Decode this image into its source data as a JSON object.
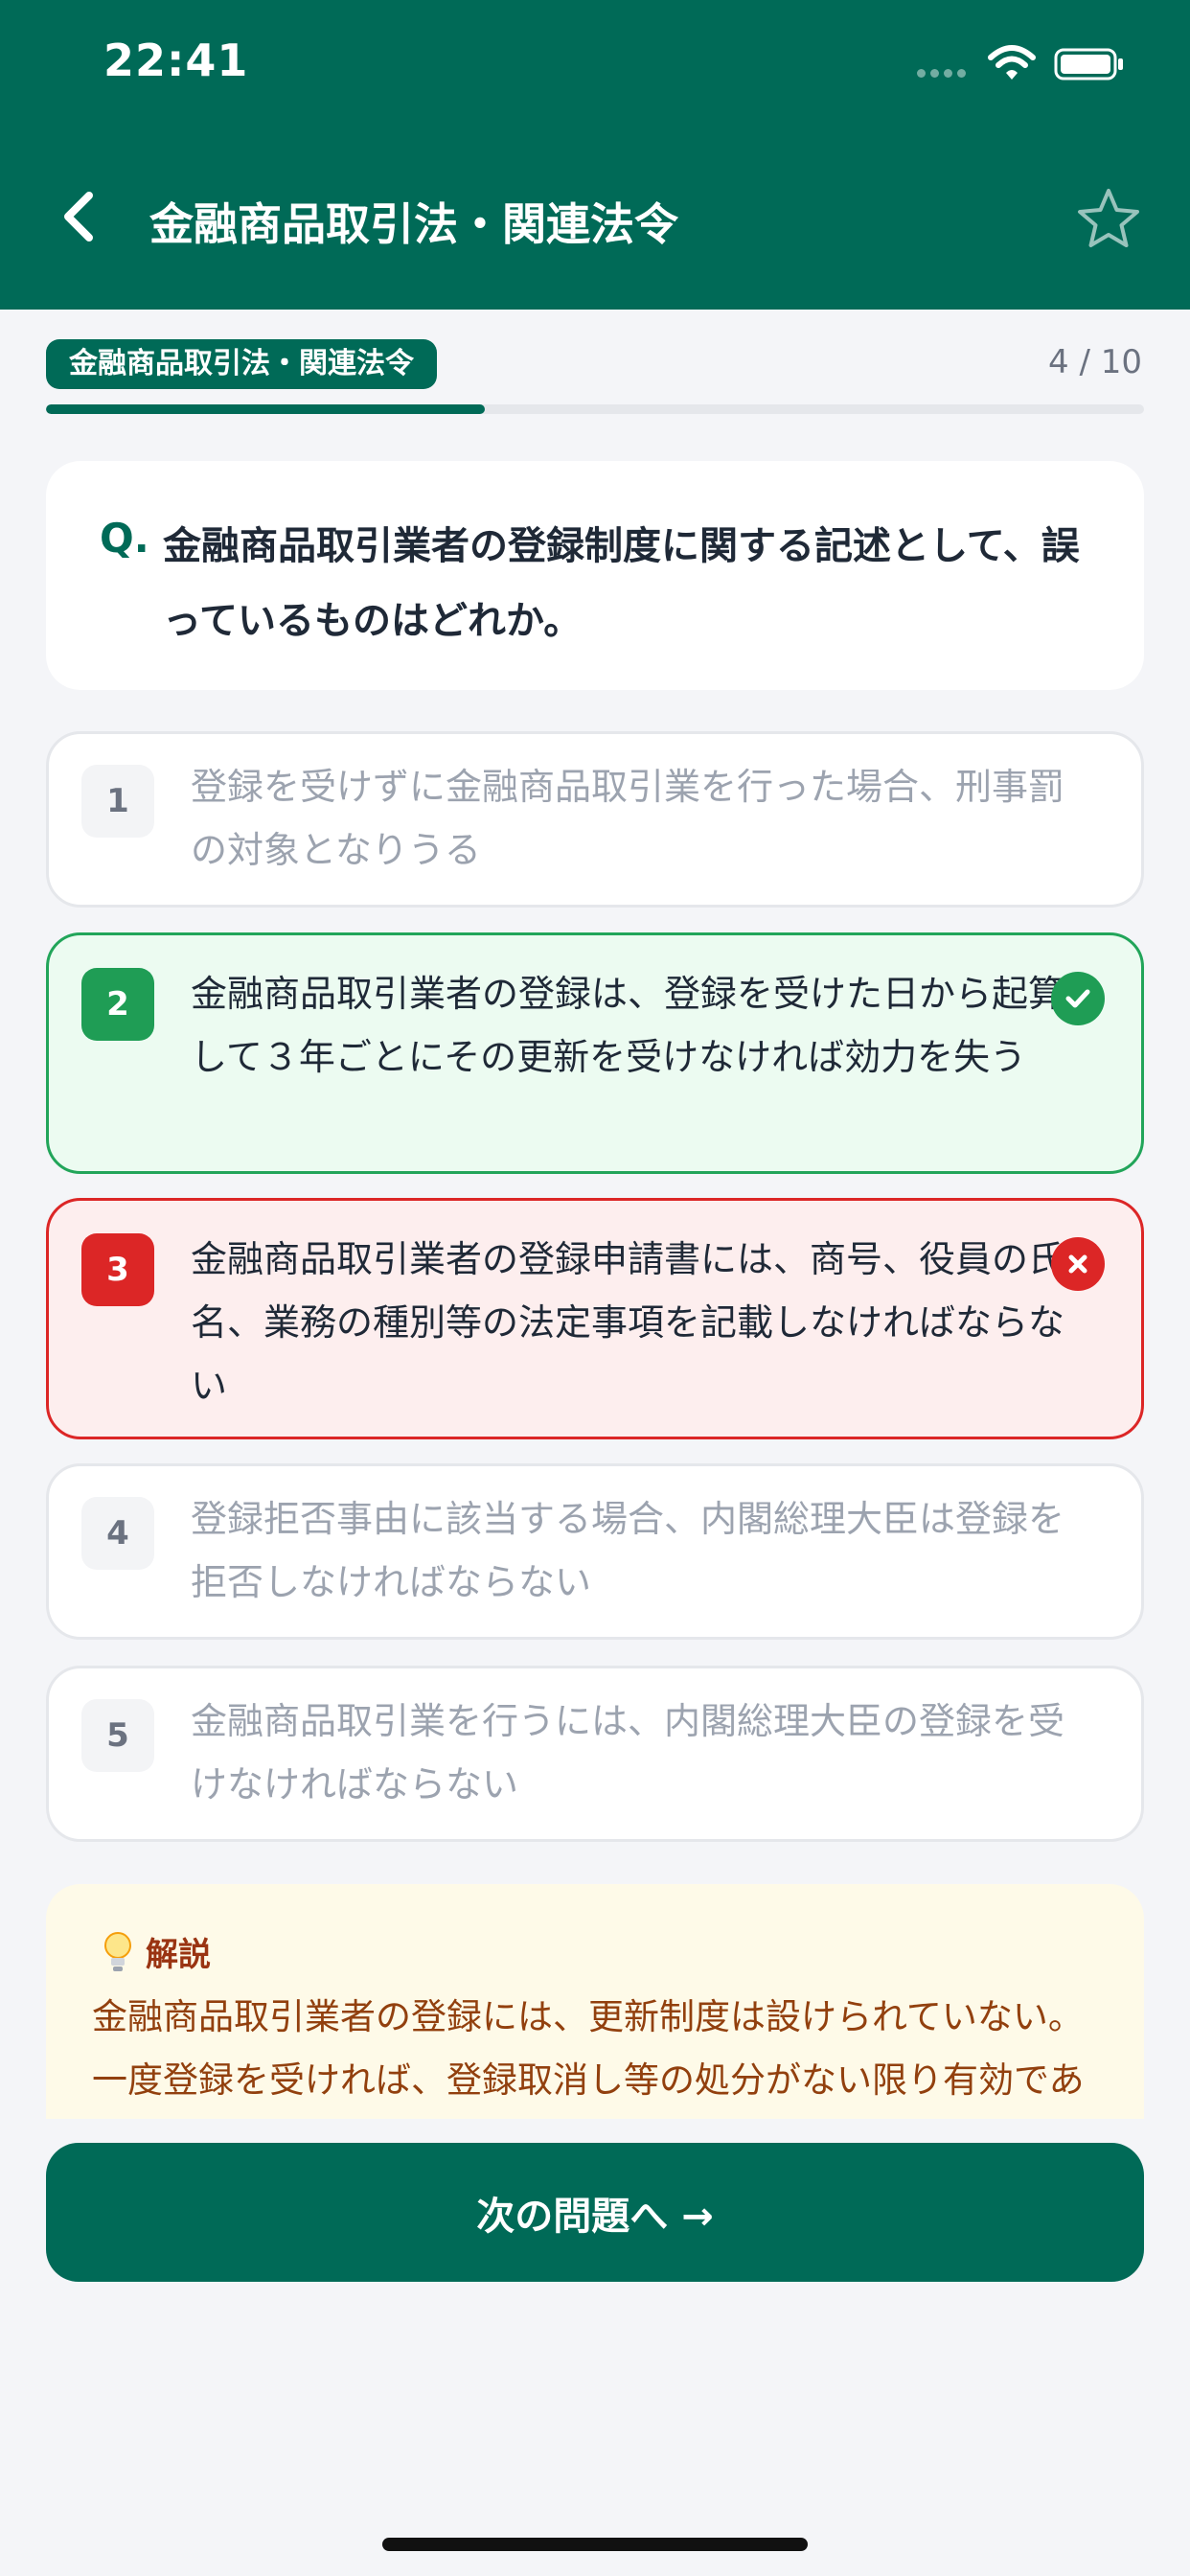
{
  "status_bar": {
    "time": "22:41"
  },
  "nav": {
    "title": "金融商品取引法・関連法令",
    "back_icon": "chevron-left-icon",
    "favorite_icon": "star-outline-icon"
  },
  "progress": {
    "topic": "金融商品取引法・関連法令",
    "count": "4 / 10",
    "fraction": 0.4
  },
  "question": {
    "prefix": "Q.",
    "text": "金融商品取引業者の登録制度に関する記述として、誤っているものはどれか。"
  },
  "options": [
    {
      "num": "1",
      "text": "登録を受けずに金融商品取引業を行った場合、刑事罰の対象となりうる",
      "state": "neutral"
    },
    {
      "num": "2",
      "text": "金融商品取引業者の登録は、登録を受けた日から起算して３年ごとにその更新を受けなければ効力を失う",
      "state": "correct"
    },
    {
      "num": "3",
      "text": "金融商品取引業者の登録申請書には、商号、役員の氏名、業務の種別等の法定事項を記載しなければならない",
      "state": "wrong"
    },
    {
      "num": "4",
      "text": "登録拒否事由に該当する場合、内閣総理大臣は登録を拒否しなければならない",
      "state": "neutral"
    },
    {
      "num": "5",
      "text": "金融商品取引業を行うには、内閣総理大臣の登録を受けなければならない",
      "state": "neutral"
    }
  ],
  "explanation": {
    "title": "解説",
    "icon": "lightbulb-icon",
    "text": "金融商品取引業者の登録には、更新制度は設けられていない。一度登録を受ければ、登録取消し等の処分がない限り有効であ"
  },
  "next_button": {
    "label": "次の問題へ →"
  },
  "colors": {
    "primary": "#006a57",
    "correct": "#1f9d55",
    "wrong": "#dc2626"
  }
}
